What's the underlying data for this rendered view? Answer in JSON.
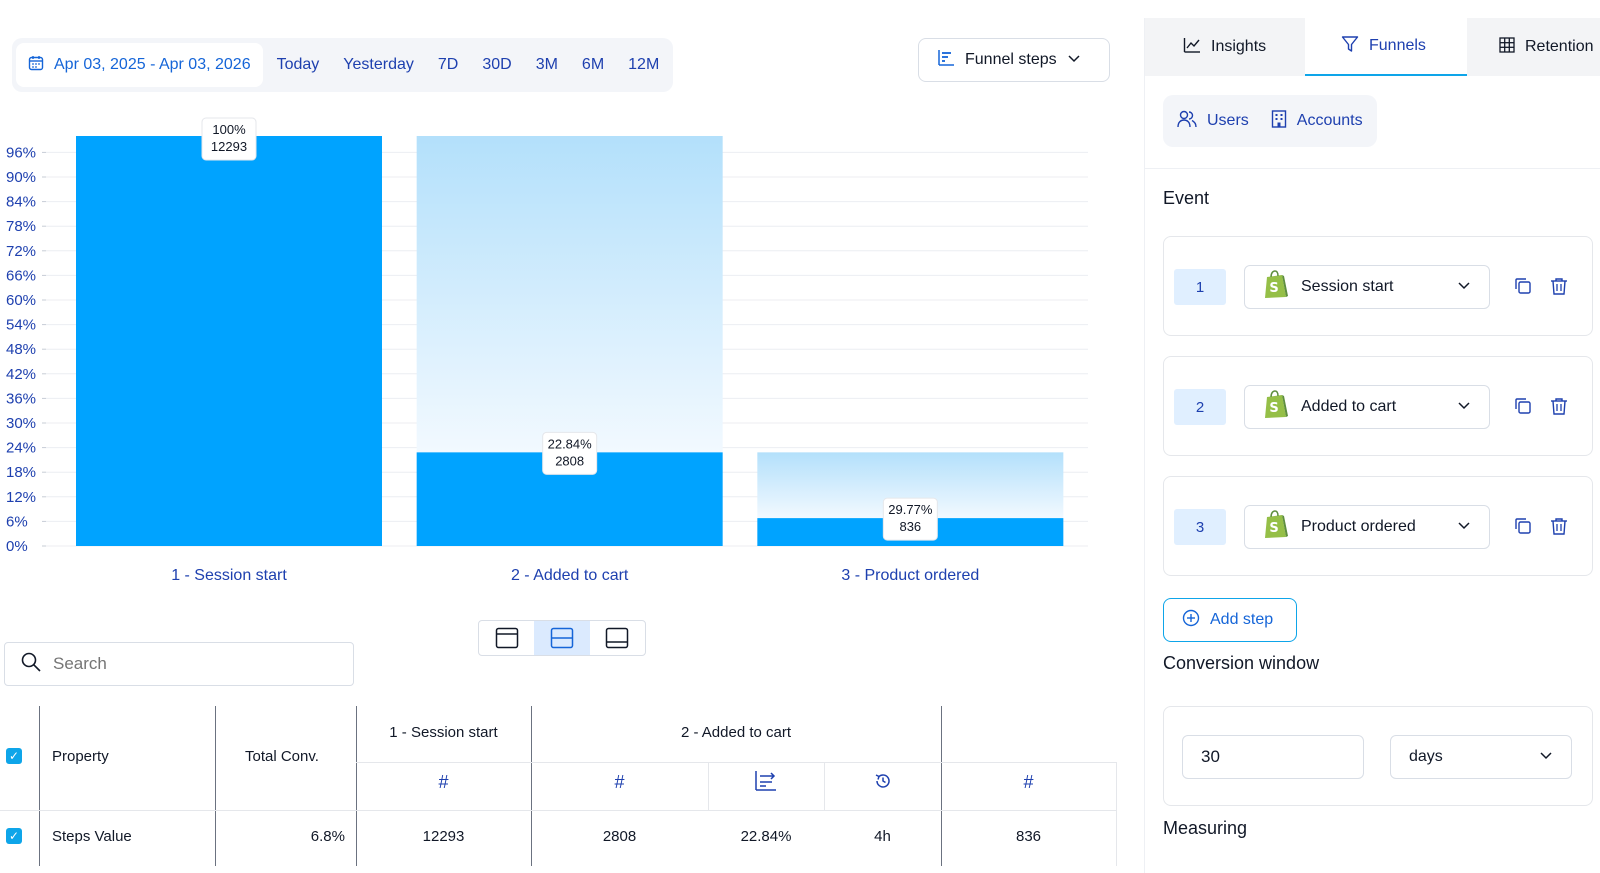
{
  "date_filter": {
    "range_label": "Apr 03, 2025 - Apr 03, 2026",
    "quick_ranges": [
      "Today",
      "Yesterday",
      "7D",
      "30D",
      "3M",
      "6M",
      "12M"
    ]
  },
  "chart_toggle": {
    "label": "Funnel steps"
  },
  "chart_data": {
    "type": "bar",
    "categories": [
      "1 - Session start",
      "2 - Added to cart",
      "3 - Product ordered"
    ],
    "values_percent": [
      100,
      22.84,
      6.8
    ],
    "values_count": [
      12293,
      2808,
      836
    ],
    "data_labels": [
      {
        "percent": "100%",
        "count": "12293"
      },
      {
        "percent": "22.84%",
        "count": "2808"
      },
      {
        "percent": "29.77%",
        "count": "836"
      }
    ],
    "y_ticks": [
      "0%",
      "6%",
      "12%",
      "18%",
      "24%",
      "30%",
      "36%",
      "42%",
      "48%",
      "54%",
      "60%",
      "66%",
      "72%",
      "78%",
      "84%",
      "90%",
      "96%"
    ],
    "ylim": [
      0,
      100
    ],
    "grid": true,
    "colors": {
      "bar": "#00a3ff",
      "dropoff_top": "#b3e0fb",
      "dropoff_bottom": "#f2f9ff",
      "axis_text": "#1e40af"
    }
  },
  "search": {
    "placeholder": "Search"
  },
  "table": {
    "headers": {
      "property": "Property",
      "total_conv": "Total Conv.",
      "step1": "1 - Session start",
      "step2": "2 - Added to cart",
      "hash": "#"
    },
    "row": {
      "label": "Steps Value",
      "total_conv": "6.8%",
      "step1_count": "12293",
      "step2_count": "2808",
      "step2_conv": "22.84%",
      "step2_time": "4h",
      "step3_count": "836"
    }
  },
  "right_panel": {
    "tabs": [
      "Insights",
      "Funnels",
      "Retention"
    ],
    "active_tab": "Funnels",
    "entity_tabs": [
      "Users",
      "Accounts"
    ],
    "event_title": "Event",
    "steps": [
      {
        "number": "1",
        "event": "Session start"
      },
      {
        "number": "2",
        "event": "Added to cart"
      },
      {
        "number": "3",
        "event": "Product ordered"
      }
    ],
    "add_step_label": "Add step",
    "conversion_window_title": "Conversion window",
    "conversion_window_value": "30",
    "conversion_window_unit": "days",
    "measuring_title": "Measuring"
  },
  "accent_color": "#0ea5e9"
}
